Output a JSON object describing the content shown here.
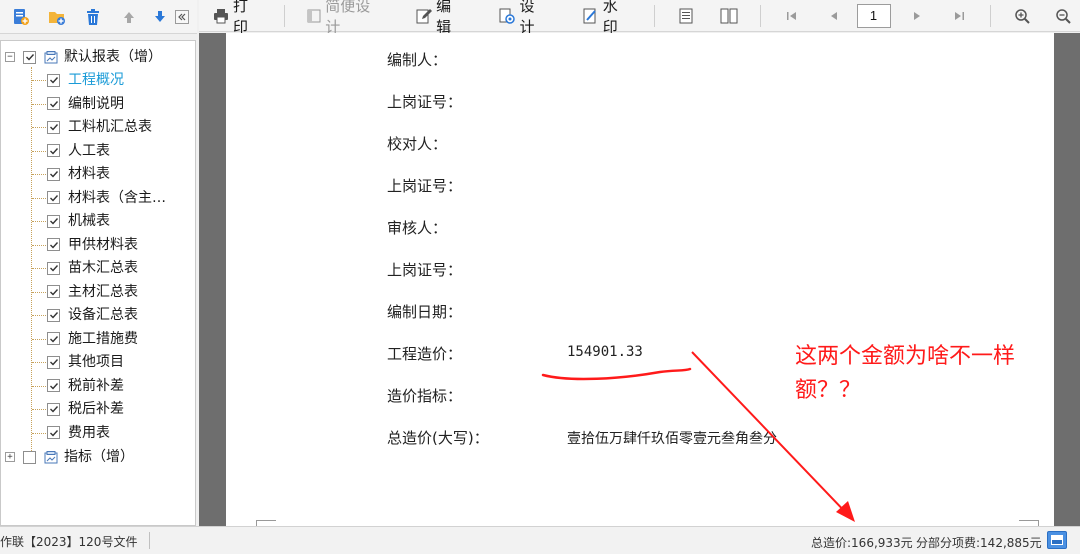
{
  "toolbar": {
    "print": "打印",
    "simple_design": "简便设计",
    "edit": "编辑",
    "design": "设计",
    "watermark": "水印",
    "page_number": "1"
  },
  "tree": {
    "root": "默认报表（增）",
    "items": [
      "工程概况",
      "编制说明",
      "工料机汇总表",
      "人工表",
      "材料表",
      "材料表（含主…",
      "机械表",
      "甲供材料表",
      "苗木汇总表",
      "主材汇总表",
      "设备汇总表",
      "施工措施费",
      "其他项目",
      "税前补差",
      "税后补差",
      "费用表"
    ],
    "active_index": 0,
    "second_root": "指标（增）"
  },
  "document": {
    "fields": [
      {
        "label": "编制人：",
        "value": ""
      },
      {
        "label": "上岗证号：",
        "value": ""
      },
      {
        "label": "校对人：",
        "value": ""
      },
      {
        "label": "上岗证号：",
        "value": ""
      },
      {
        "label": "审核人：",
        "value": ""
      },
      {
        "label": "上岗证号：",
        "value": ""
      },
      {
        "label": "编制日期：",
        "value": ""
      },
      {
        "label": "工程造价：",
        "value": "154901.33"
      },
      {
        "label": "造价指标：",
        "value": ""
      },
      {
        "label": "总造价(大写)：",
        "value": "壹拾伍万肆仟玖佰零壹元叁角叁分"
      }
    ]
  },
  "annotation": {
    "line1": "这两个金额为啥不一样",
    "line2": "额？？",
    "color": "#ff1a1a"
  },
  "status": {
    "left_text": "作联【2023】120号文件",
    "total_cost": "总造价:166,933元",
    "sub_cost": "分部分项费:142,885元"
  },
  "colors": {
    "active_tree_item": "#1a9bd7",
    "viewport_bg": "#6e6e6e",
    "annotation_red": "#ff1a1a"
  }
}
